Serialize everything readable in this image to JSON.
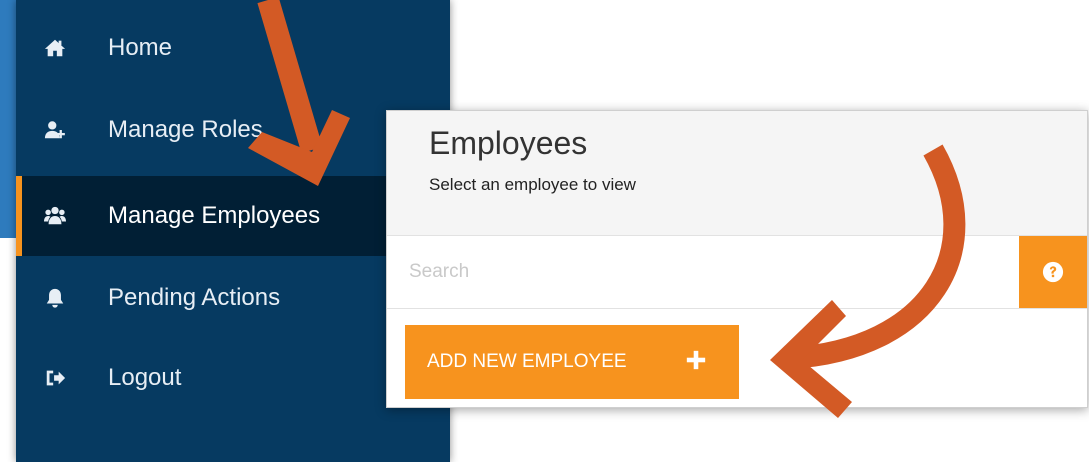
{
  "sidebar": {
    "items": [
      {
        "label": "Home",
        "icon": "home-icon"
      },
      {
        "label": "Manage Roles",
        "icon": "add-user-icon"
      },
      {
        "label": "Manage Employees",
        "icon": "users-icon",
        "active": true
      },
      {
        "label": "Pending Actions",
        "icon": "bell-icon"
      },
      {
        "label": "Logout",
        "icon": "sign-out-icon"
      }
    ]
  },
  "panel": {
    "title": "Employees",
    "subtitle": "Select an employee to view",
    "search_placeholder": "Search",
    "search_value": "",
    "help_icon": "question-circle-icon",
    "add_label": "ADD NEW EMPLOYEE",
    "add_icon": "plus-icon"
  },
  "colors": {
    "sidebar_bg": "#063a61",
    "sidebar_active_bg": "#011f35",
    "accent_orange": "#f7931e",
    "annotation_arrow": "#d35a25",
    "background_blue": "#2e7bbd"
  }
}
